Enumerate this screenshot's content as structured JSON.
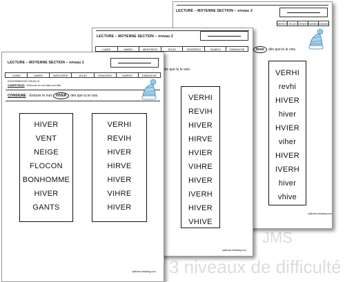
{
  "days": [
    "LUNDI",
    "MARDI",
    "MERCREDI",
    "JEUDI",
    "VENDREDI",
    "SAMEDI",
    "DIMANCHE"
  ],
  "sheet3": {
    "title": "LECTURE – MOYENNE SECTION",
    "level": "niveau 3",
    "instruction_tail": "dès que tu le vois.",
    "circled_word": "hiver",
    "words": [
      "VERHI",
      "revhi",
      "HIVER",
      "hiver",
      "HVIER",
      "viher",
      "HIVER",
      "IVERH",
      "hiver",
      "vhive"
    ],
    "footer": "vplilosec.eklablog.com"
  },
  "sheet2": {
    "title": "LECTURE – MOYENNE SECTION",
    "level": "niveau 2",
    "instruction_tail": "dès que tu le vois.",
    "words": [
      "VERHI",
      "REVIH",
      "HIVER",
      "HIRVE",
      "HVIER",
      "VIHRE",
      "HIVER",
      "IVERH",
      "HIVER",
      "VHIVE"
    ],
    "footer": "vplilosec.eklablog.com"
  },
  "sheet1": {
    "title": "LECTURE – MOYENNE SECTION",
    "level": "niveau 1",
    "discrimination": "DISCRIMINATION VISUELLE",
    "competence_label": "COMPETENCE",
    "competence_text": ": Retrouver un mot dans une liste",
    "consigne_label": "CONSIGNE",
    "consigne_text": ": Entoure le mot",
    "circled_word": "HIVER",
    "consigne_tail": "dès que tu le vois.",
    "col1": [
      "HIVER",
      "VENT",
      "NEIGE",
      "FLOCON",
      "BONHOMME",
      "HIVER",
      "GANTS"
    ],
    "col2": [
      "VERHI",
      "REVIH",
      "HIVER",
      "HIRVE",
      "HIVER",
      "VIHRE",
      "HIVER"
    ],
    "footer": "vplilosec.eklablog.com"
  },
  "background_caption": {
    "line1": "JMS",
    "line2": "3 niveaux de difficulté"
  }
}
